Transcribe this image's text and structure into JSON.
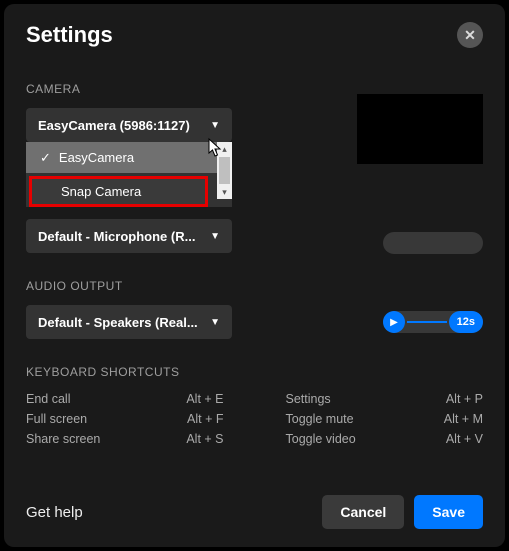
{
  "title": "Settings",
  "camera": {
    "label": "CAMERA",
    "selected": "EasyCamera (5986:1127)",
    "options": [
      {
        "label": "EasyCamera",
        "selected": true
      },
      {
        "label": "Snap Camera",
        "selected": false,
        "highlighted": true
      }
    ]
  },
  "audioInput": {
    "selected": "Default - Microphone (R..."
  },
  "audioOutput": {
    "label": "AUDIO OUTPUT",
    "selected": "Default - Speakers (Real...",
    "time": "12s"
  },
  "shortcuts": {
    "label": "KEYBOARD SHORTCUTS",
    "left": [
      {
        "name": "End call",
        "key": "Alt + E"
      },
      {
        "name": "Full screen",
        "key": "Alt + F"
      },
      {
        "name": "Share screen",
        "key": "Alt + S"
      }
    ],
    "right": [
      {
        "name": "Settings",
        "key": "Alt + P"
      },
      {
        "name": "Toggle mute",
        "key": "Alt + M"
      },
      {
        "name": "Toggle video",
        "key": "Alt + V"
      }
    ]
  },
  "footer": {
    "help": "Get help",
    "cancel": "Cancel",
    "save": "Save"
  }
}
